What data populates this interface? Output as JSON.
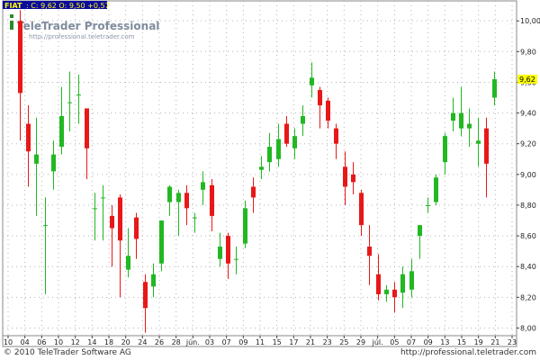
{
  "header": {
    "symbol": "FIAT",
    "quote_text": ": C: 9,62 O: 9,50 +0,57"
  },
  "watermark": {
    "brand": "TeleTrader Professional",
    "url": "http://professional.teletrader.com"
  },
  "footer": {
    "copyright": "© 2010 TeleTrader Software AG",
    "url": "http://professional.teletrader.com"
  },
  "colors": {
    "up": "#22b822",
    "down": "#e81818",
    "header_bar": "#0a0aa0",
    "header_text": "#ffff00",
    "grid": "#b4b4b4",
    "last_price_bg": "#ffff00"
  },
  "chart_data": {
    "type": "candlestick",
    "instrument": "FIAT",
    "last_close": 9.62,
    "y_axis": {
      "ylim": [
        7.95,
        10.13
      ],
      "ticks": [
        "8,00",
        "8,20",
        "8,40",
        "8,60",
        "8,80",
        "9,00",
        "9,20",
        "9,40",
        "9,60",
        "9,80",
        "10,00"
      ],
      "side": "right"
    },
    "x_axis": {
      "tick_labels": [
        "10",
        "04",
        "06",
        "10",
        "12",
        "14",
        "18",
        "20",
        "24",
        "26",
        "28",
        "jún.",
        "03",
        "07",
        "09",
        "11",
        "15",
        "17",
        "21",
        "23",
        "25",
        "29",
        "júl.",
        "05",
        "07",
        "09",
        "13",
        "15",
        "19",
        "21",
        "23"
      ]
    },
    "grid": true,
    "candles": [
      {
        "o": 10.0,
        "h": 10.07,
        "l": 9.22,
        "c": 9.53
      },
      {
        "o": 9.33,
        "h": 9.45,
        "l": 8.92,
        "c": 9.15
      },
      {
        "o": 9.07,
        "h": 9.37,
        "l": 8.73,
        "c": 9.13
      },
      {
        "o": 8.67,
        "h": 8.85,
        "l": 8.22,
        "c": 8.67
      },
      {
        "o": 9.02,
        "h": 9.22,
        "l": 8.9,
        "c": 9.13
      },
      {
        "o": 9.18,
        "h": 9.57,
        "l": 9.13,
        "c": 9.38
      },
      {
        "o": 9.47,
        "h": 9.67,
        "l": 9.28,
        "c": 9.47
      },
      {
        "o": 9.52,
        "h": 9.65,
        "l": 9.33,
        "c": 9.52
      },
      {
        "o": 9.43,
        "h": 9.43,
        "l": 8.97,
        "c": 9.17
      },
      {
        "o": 8.78,
        "h": 8.88,
        "l": 8.57,
        "c": 8.78
      },
      {
        "o": 8.85,
        "h": 8.93,
        "l": 8.57,
        "c": 8.85
      },
      {
        "o": 8.73,
        "h": 8.8,
        "l": 8.4,
        "c": 8.65
      },
      {
        "o": 8.85,
        "h": 8.87,
        "l": 8.2,
        "c": 8.57
      },
      {
        "o": 8.38,
        "h": 8.65,
        "l": 8.33,
        "c": 8.47
      },
      {
        "o": 8.72,
        "h": 8.75,
        "l": 8.45,
        "c": 8.58
      },
      {
        "o": 8.3,
        "h": 8.35,
        "l": 7.97,
        "c": 8.13
      },
      {
        "o": 8.27,
        "h": 8.42,
        "l": 8.2,
        "c": 8.35
      },
      {
        "o": 8.42,
        "h": 8.65,
        "l": 8.37,
        "c": 8.7
      },
      {
        "o": 8.82,
        "h": 8.93,
        "l": 8.73,
        "c": 8.92
      },
      {
        "o": 8.82,
        "h": 8.9,
        "l": 8.6,
        "c": 8.88
      },
      {
        "o": 8.88,
        "h": 8.93,
        "l": 8.67,
        "c": 8.78
      },
      {
        "o": 8.72,
        "h": 8.75,
        "l": 8.62,
        "c": 8.72
      },
      {
        "o": 8.9,
        "h": 9.02,
        "l": 8.8,
        "c": 8.95
      },
      {
        "o": 8.93,
        "h": 8.97,
        "l": 8.63,
        "c": 8.73
      },
      {
        "o": 8.45,
        "h": 8.62,
        "l": 8.4,
        "c": 8.53
      },
      {
        "o": 8.6,
        "h": 8.62,
        "l": 8.32,
        "c": 8.42
      },
      {
        "o": 8.45,
        "h": 8.53,
        "l": 8.35,
        "c": 8.45
      },
      {
        "o": 8.55,
        "h": 8.83,
        "l": 8.52,
        "c": 8.78
      },
      {
        "o": 8.92,
        "h": 8.98,
        "l": 8.75,
        "c": 8.85
      },
      {
        "o": 9.03,
        "h": 9.12,
        "l": 8.97,
        "c": 9.05
      },
      {
        "o": 9.08,
        "h": 9.27,
        "l": 9.02,
        "c": 9.18
      },
      {
        "o": 9.1,
        "h": 9.33,
        "l": 9.05,
        "c": 9.23
      },
      {
        "o": 9.33,
        "h": 9.38,
        "l": 9.18,
        "c": 9.2
      },
      {
        "o": 9.17,
        "h": 9.3,
        "l": 9.1,
        "c": 9.25
      },
      {
        "o": 9.33,
        "h": 9.45,
        "l": 9.25,
        "c": 9.38
      },
      {
        "o": 9.58,
        "h": 9.73,
        "l": 9.5,
        "c": 9.63
      },
      {
        "o": 9.55,
        "h": 9.57,
        "l": 9.3,
        "c": 9.45
      },
      {
        "o": 9.48,
        "h": 9.5,
        "l": 9.3,
        "c": 9.35
      },
      {
        "o": 9.3,
        "h": 9.33,
        "l": 9.1,
        "c": 9.2
      },
      {
        "o": 9.05,
        "h": 9.15,
        "l": 8.8,
        "c": 8.92
      },
      {
        "o": 9.0,
        "h": 9.08,
        "l": 8.87,
        "c": 8.95
      },
      {
        "o": 8.88,
        "h": 8.9,
        "l": 8.6,
        "c": 8.67
      },
      {
        "o": 8.53,
        "h": 8.67,
        "l": 8.28,
        "c": 8.47
      },
      {
        "o": 8.35,
        "h": 8.48,
        "l": 8.18,
        "c": 8.22
      },
      {
        "o": 8.22,
        "h": 8.28,
        "l": 8.17,
        "c": 8.25
      },
      {
        "o": 8.25,
        "h": 8.3,
        "l": 8.1,
        "c": 8.2
      },
      {
        "o": 8.23,
        "h": 8.4,
        "l": 8.13,
        "c": 8.35
      },
      {
        "o": 8.25,
        "h": 8.45,
        "l": 8.2,
        "c": 8.37
      },
      {
        "o": 8.6,
        "h": 8.67,
        "l": 8.45,
        "c": 8.67
      },
      {
        "o": 8.8,
        "h": 8.85,
        "l": 8.75,
        "c": 8.8
      },
      {
        "o": 8.82,
        "h": 9.0,
        "l": 8.8,
        "c": 8.98
      },
      {
        "o": 9.08,
        "h": 9.27,
        "l": 9.0,
        "c": 9.25
      },
      {
        "o": 9.35,
        "h": 9.5,
        "l": 9.28,
        "c": 9.4
      },
      {
        "o": 9.3,
        "h": 9.57,
        "l": 9.25,
        "c": 9.4
      },
      {
        "o": 9.3,
        "h": 9.43,
        "l": 9.18,
        "c": 9.33
      },
      {
        "o": 9.2,
        "h": 9.37,
        "l": 9.05,
        "c": 9.22
      },
      {
        "o": 9.3,
        "h": 9.37,
        "l": 8.85,
        "c": 9.07
      },
      {
        "o": 9.5,
        "h": 9.67,
        "l": 9.45,
        "c": 9.62
      }
    ]
  }
}
